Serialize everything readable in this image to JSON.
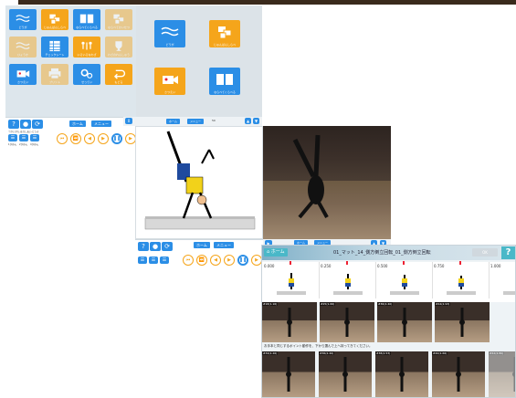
{
  "colors": {
    "primary_blue": "#2b8ee6",
    "accent_orange": "#f5a51b",
    "help_teal": "#4ab8c8",
    "window_bg": "#dde6ec"
  },
  "menu_tiles": [
    {
      "label": "どうが",
      "icon": "wave-icon",
      "color": "blue"
    },
    {
      "label": "じゅんばんしらべ",
      "icon": "card-stack-icon",
      "color": "orange"
    },
    {
      "label": "ならべてくらべる",
      "icon": "compare-icon",
      "color": "blue"
    },
    {
      "label": "ならべてかいせつ",
      "icon": "card-stack-icon",
      "color": "orange",
      "faded": true
    },
    {
      "label": "ひょうか",
      "icon": "wave-icon",
      "color": "orange",
      "faded": true
    },
    {
      "label": "チェックシート",
      "icon": "grid-icon",
      "color": "blue"
    },
    {
      "label": "いろいろなわざ",
      "icon": "people-icon",
      "color": "orange"
    },
    {
      "label": "わざのれんしゅう",
      "icon": "trophy-icon",
      "color": "orange",
      "faded": true
    },
    {
      "label": "さつえい",
      "icon": "camera-icon",
      "color": "blue"
    },
    {
      "label": "プリント",
      "icon": "printer-icon",
      "color": "orange",
      "faded": true
    },
    {
      "label": "せってい",
      "icon": "gear-icon",
      "color": "blue"
    },
    {
      "label": "もどる",
      "icon": "back-icon",
      "color": "orange"
    }
  ],
  "side_tiles": [
    {
      "label": "どうが",
      "icon": "wave-icon",
      "color": "blue"
    },
    {
      "label": "じゅんばんしらべ",
      "icon": "card-stack-icon",
      "color": "orange"
    },
    {
      "label": "さつえい",
      "icon": "camera-icon",
      "color": "orange"
    },
    {
      "label": "ならべてくらべる",
      "icon": "compare-icon",
      "color": "blue"
    }
  ],
  "toolbar": {
    "help": "?",
    "help_label": "つかいかた",
    "chat_label": "はなしあい",
    "sync_label": "どうき",
    "home_label": "ホーム",
    "menu_label": "メニュー",
    "layout1_label": "1がめん",
    "layout2_label": "2がめん",
    "layout4_label": "4がめん",
    "count": "0",
    "zoom_value": "50"
  },
  "player": {
    "title": "01_マット_14_側方倒立回転_01_側方倒立回転",
    "home_label": "ホーム",
    "timeline": [
      "0.000",
      "0.250",
      "0.500",
      "0.750",
      "1.000"
    ],
    "frame_caps": [
      "#18(1.16)",
      "#25(1.66)",
      "#36(2.40)",
      "#44(2.93)"
    ],
    "instruction": "お手本と同じするポイント動作を、下から選んで上へ持ってきてください。",
    "strip_caps": [
      "#34(2.26)",
      "#36(2.40)",
      "#38(2.53)",
      "#40(2.66)",
      "#42(2.80)",
      "#44(2.93)"
    ],
    "ok_label": "OK",
    "help": "?"
  }
}
